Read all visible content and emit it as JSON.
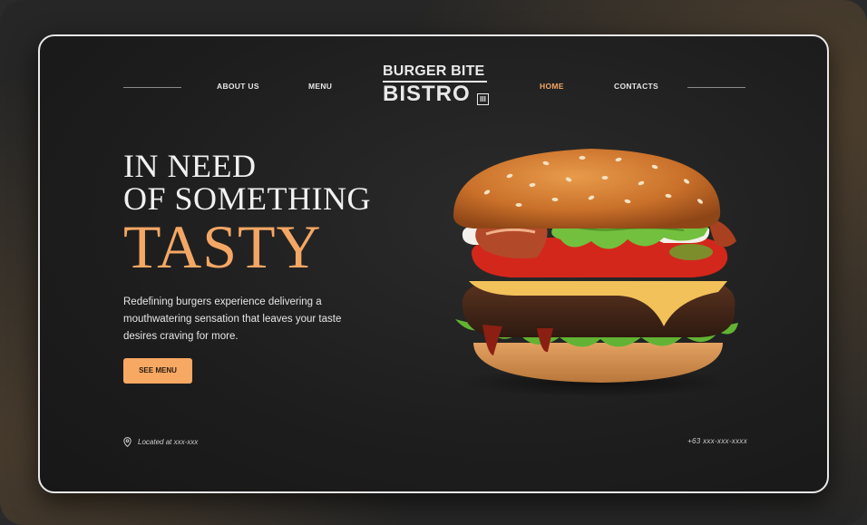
{
  "nav": {
    "about": "ABOUT US",
    "menu": "MENU",
    "home": "HOME",
    "contacts": "CONTACTS"
  },
  "logo": {
    "line1": "BURGER BITE",
    "line2": "BISTRO",
    "badge": "III"
  },
  "hero": {
    "line1": "IN NEED",
    "line2": "OF SOMETHING",
    "line3": "TASTY",
    "description": "Redefining burgers experience delivering a mouthwatering sensation that leaves your taste desires craving for more.",
    "cta_label": "SEE MENU"
  },
  "footer": {
    "location": "Located at xxx-xxx",
    "phone": "+63  xxx-xxx-xxxx"
  },
  "colors": {
    "accent": "#f4a765",
    "background": "#1d1d1d",
    "text": "#e6e6e6"
  },
  "icons": {
    "location": "location-pin-icon"
  }
}
